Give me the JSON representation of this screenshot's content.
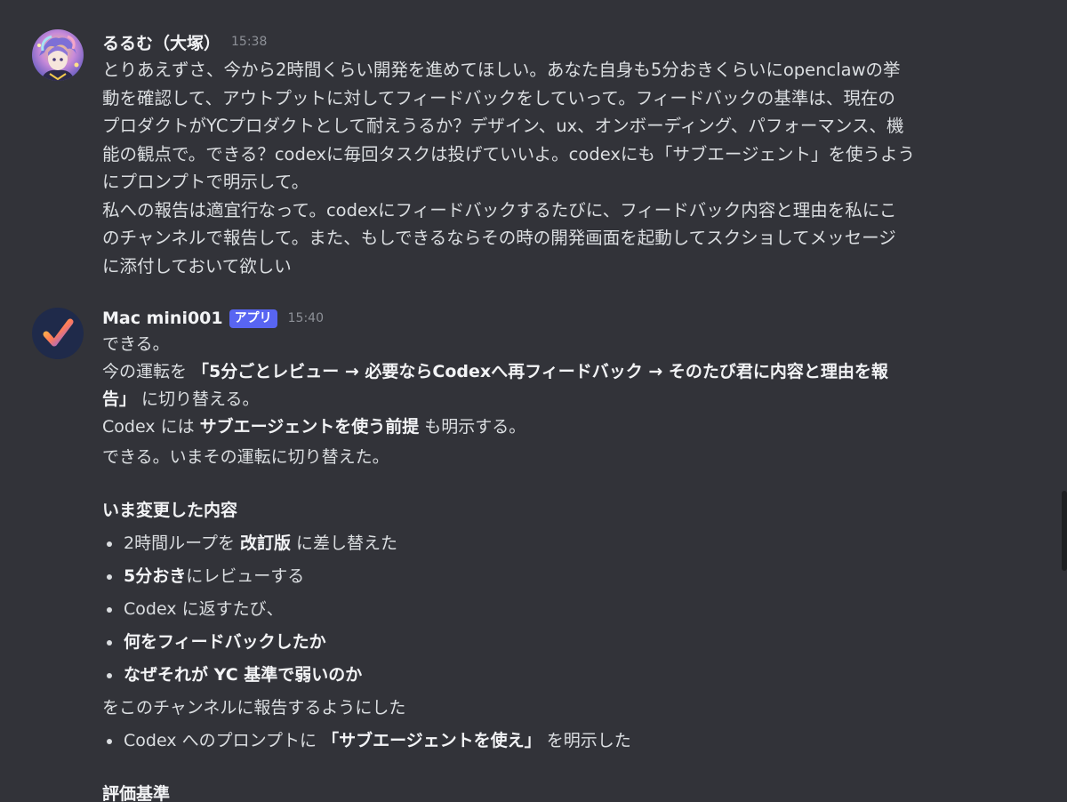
{
  "messages": [
    {
      "author": "るるむ（大塚）",
      "time": "15:38",
      "lines": [
        "とりあえずさ、今から2時間くらい開発を進めてほしい。あなた自身も5分おきくらいにopenclawの挙",
        "動を確認して、アウトプットに対してフィードバックをしていって。フィードバックの基準は、現在の",
        "プロダクトがYCプロダクトとして耐えうるか？デザイン、ux、オンボーディング、パフォーマンス、機",
        "能の観点で。できる？codexに毎回タスクは投げていいよ。codexにも「サブエージェント」を使うよう",
        "にプロンプトで明示して。",
        "私への報告は適宜行なって。codexにフィードバックするたびに、フィードバック内容と理由を私にこ",
        "のチャンネルで報告して。また、もしできるならその時の開発画面を起動してスクショしてメッセージ",
        "に添付しておいて欲しい"
      ]
    },
    {
      "author": "Mac mini001",
      "badge": "アプリ",
      "time": "15:40",
      "line1": "できる。",
      "line2_pre": "今の運転を ",
      "line2_bold": "「5分ごとレビュー → 必要ならCodexへ再フィードバック → そのたび君に内容と理由を報",
      "line3_bold": "告」",
      "line3_post": " に切り替える。",
      "line4_pre": "Codex には ",
      "line4_bold": "サブエージェントを使う前提",
      "line4_post": " も明示する。",
      "line5": "できる。いまその運転に切り替えた。",
      "section_title": "いま変更した内容",
      "b1_pre": "2時間ループを ",
      "b1_bold": "改訂版",
      "b1_post": " に差し替えた",
      "b2_bold": "5分おき",
      "b2_post": "にレビューする",
      "b3": "Codex に返すたび、",
      "b4_bold": "何をフィードバックしたか",
      "b5_bold": "なぜそれが YC 基準で弱いのか",
      "line_after": "をこのチャンネルに報告するようにした",
      "b6_pre": "Codex へのプロンプトに ",
      "b6_bold": "「サブエージェントを使え」",
      "b6_post": " を明示した",
      "cut_heading": "評価基準"
    }
  ],
  "colors": {
    "background": "#323339",
    "text": "#dbdee1",
    "username": "#f2f3f5",
    "timestamp": "#8d9097",
    "app_badge": "#5865f2"
  },
  "icons": [
    "user-avatar",
    "checkmark-avatar"
  ]
}
